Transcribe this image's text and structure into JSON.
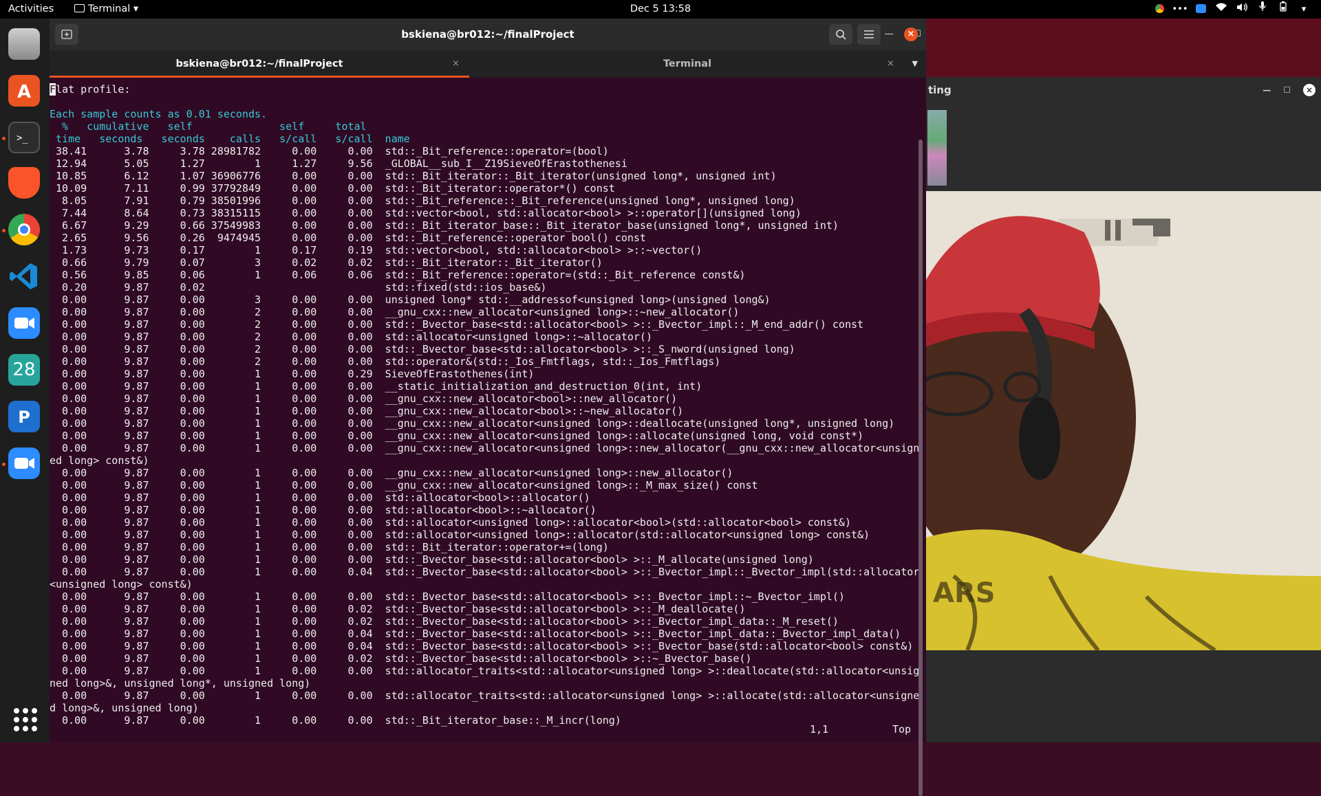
{
  "topbar": {
    "activities": "Activities",
    "app_menu": "Terminal",
    "clock": "Dec 5  13:58"
  },
  "dock": {
    "items": [
      {
        "name": "files",
        "color": "#8a8a8a"
      },
      {
        "name": "ubuntu-software",
        "color": "#e95420"
      },
      {
        "name": "terminal",
        "color": "#2c2c2c"
      },
      {
        "name": "brave",
        "color": "#fb542b"
      },
      {
        "name": "chrome",
        "color": "#4285f4"
      },
      {
        "name": "vscode",
        "color": "#007acc"
      },
      {
        "name": "zoom",
        "color": "#2d8cff"
      },
      {
        "name": "calendar",
        "color": "#27a59a",
        "label": "28"
      },
      {
        "name": "cloud-app",
        "color": "#1f6fd1"
      },
      {
        "name": "zoom-2",
        "color": "#2d8cff"
      }
    ]
  },
  "terminal": {
    "title": "bskiena@br012:~/finalProject",
    "tabs": [
      {
        "label": "bskiena@br012:~/finalProject",
        "close": "×"
      },
      {
        "label": "Terminal",
        "close": "×"
      }
    ],
    "first_char": "F",
    "first_rest": "lat profile:",
    "header": [
      "",
      "Each sample counts as 0.01 seconds.",
      "  %   cumulative   self              self     total",
      " time   seconds   seconds    calls   s/call   s/call  name"
    ],
    "rows": [
      " 38.41      3.78     3.78 28981782     0.00     0.00  std::_Bit_reference::operator=(bool)",
      " 12.94      5.05     1.27        1     1.27     9.56  _GLOBAL__sub_I__Z19SieveOfErastothenesi",
      " 10.85      6.12     1.07 36906776     0.00     0.00  std::_Bit_iterator::_Bit_iterator(unsigned long*, unsigned int)",
      " 10.09      7.11     0.99 37792849     0.00     0.00  std::_Bit_iterator::operator*() const",
      "  8.05      7.91     0.79 38501996     0.00     0.00  std::_Bit_reference::_Bit_reference(unsigned long*, unsigned long)",
      "  7.44      8.64     0.73 38315115     0.00     0.00  std::vector<bool, std::allocator<bool> >::operator[](unsigned long)",
      "  6.67      9.29     0.66 37549983     0.00     0.00  std::_Bit_iterator_base::_Bit_iterator_base(unsigned long*, unsigned int)",
      "  2.65      9.56     0.26  9474945     0.00     0.00  std::_Bit_reference::operator bool() const",
      "  1.73      9.73     0.17        1     0.17     0.19  std::vector<bool, std::allocator<bool> >::~vector()",
      "  0.66      9.79     0.07        3     0.02     0.02  std::_Bit_iterator::_Bit_iterator()",
      "  0.56      9.85     0.06        1     0.06     0.06  std::_Bit_reference::operator=(std::_Bit_reference const&)",
      "  0.20      9.87     0.02                             std::fixed(std::ios_base&)",
      "  0.00      9.87     0.00        3     0.00     0.00  unsigned long* std::__addressof<unsigned long>(unsigned long&)",
      "  0.00      9.87     0.00        2     0.00     0.00  __gnu_cxx::new_allocator<unsigned long>::~new_allocator()",
      "  0.00      9.87     0.00        2     0.00     0.00  std::_Bvector_base<std::allocator<bool> >::_Bvector_impl::_M_end_addr() const",
      "  0.00      9.87     0.00        2     0.00     0.00  std::allocator<unsigned long>::~allocator()",
      "  0.00      9.87     0.00        2     0.00     0.00  std::_Bvector_base<std::allocator<bool> >::_S_nword(unsigned long)",
      "  0.00      9.87     0.00        2     0.00     0.00  std::operator&(std::_Ios_Fmtflags, std::_Ios_Fmtflags)",
      "  0.00      9.87     0.00        1     0.00     0.29  SieveOfErastothenes(int)",
      "  0.00      9.87     0.00        1     0.00     0.00  __static_initialization_and_destruction_0(int, int)",
      "  0.00      9.87     0.00        1     0.00     0.00  __gnu_cxx::new_allocator<bool>::new_allocator()",
      "  0.00      9.87     0.00        1     0.00     0.00  __gnu_cxx::new_allocator<bool>::~new_allocator()",
      "  0.00      9.87     0.00        1     0.00     0.00  __gnu_cxx::new_allocator<unsigned long>::deallocate(unsigned long*, unsigned long)",
      "  0.00      9.87     0.00        1     0.00     0.00  __gnu_cxx::new_allocator<unsigned long>::allocate(unsigned long, void const*)",
      "  0.00      9.87     0.00        1     0.00     0.00  __gnu_cxx::new_allocator<unsigned long>::new_allocator(__gnu_cxx::new_allocator<unsign",
      "ed long> const&)",
      "  0.00      9.87     0.00        1     0.00     0.00  __gnu_cxx::new_allocator<unsigned long>::new_allocator()",
      "  0.00      9.87     0.00        1     0.00     0.00  __gnu_cxx::new_allocator<unsigned long>::_M_max_size() const",
      "  0.00      9.87     0.00        1     0.00     0.00  std::allocator<bool>::allocator()",
      "  0.00      9.87     0.00        1     0.00     0.00  std::allocator<bool>::~allocator()",
      "  0.00      9.87     0.00        1     0.00     0.00  std::allocator<unsigned long>::allocator<bool>(std::allocator<bool> const&)",
      "  0.00      9.87     0.00        1     0.00     0.00  std::allocator<unsigned long>::allocator(std::allocator<unsigned long> const&)",
      "  0.00      9.87     0.00        1     0.00     0.00  std::_Bit_iterator::operator+=(long)",
      "  0.00      9.87     0.00        1     0.00     0.00  std::_Bvector_base<std::allocator<bool> >::_M_allocate(unsigned long)",
      "  0.00      9.87     0.00        1     0.00     0.04  std::_Bvector_base<std::allocator<bool> >::_Bvector_impl::_Bvector_impl(std::allocator",
      "<unsigned long> const&)",
      "  0.00      9.87     0.00        1     0.00     0.00  std::_Bvector_base<std::allocator<bool> >::_Bvector_impl::~_Bvector_impl()",
      "  0.00      9.87     0.00        1     0.00     0.02  std::_Bvector_base<std::allocator<bool> >::_M_deallocate()",
      "  0.00      9.87     0.00        1     0.00     0.02  std::_Bvector_base<std::allocator<bool> >::_Bvector_impl_data::_M_reset()",
      "  0.00      9.87     0.00        1     0.00     0.04  std::_Bvector_base<std::allocator<bool> >::_Bvector_impl_data::_Bvector_impl_data()",
      "  0.00      9.87     0.00        1     0.00     0.04  std::_Bvector_base<std::allocator<bool> >::_Bvector_base(std::allocator<bool> const&)",
      "  0.00      9.87     0.00        1     0.00     0.02  std::_Bvector_base<std::allocator<bool> >::~_Bvector_base()",
      "  0.00      9.87     0.00        1     0.00     0.00  std::allocator_traits<std::allocator<unsigned long> >::deallocate(std::allocator<unsig",
      "ned long>&, unsigned long*, unsigned long)",
      "  0.00      9.87     0.00        1     0.00     0.00  std::allocator_traits<std::allocator<unsigned long> >::allocate(std::allocator<unsigne",
      "d long>&, unsigned long)",
      "  0.00      9.87     0.00        1     0.00     0.00  std::_Bit_iterator_base::_M_incr(long)"
    ],
    "status_pos": "1,1",
    "status_scroll": "Top"
  },
  "background_window": {
    "title": "ting"
  },
  "colors": {
    "terminal_bg": "#300a24",
    "header_cyan": "#36c9d6",
    "accent": "#e95420"
  }
}
